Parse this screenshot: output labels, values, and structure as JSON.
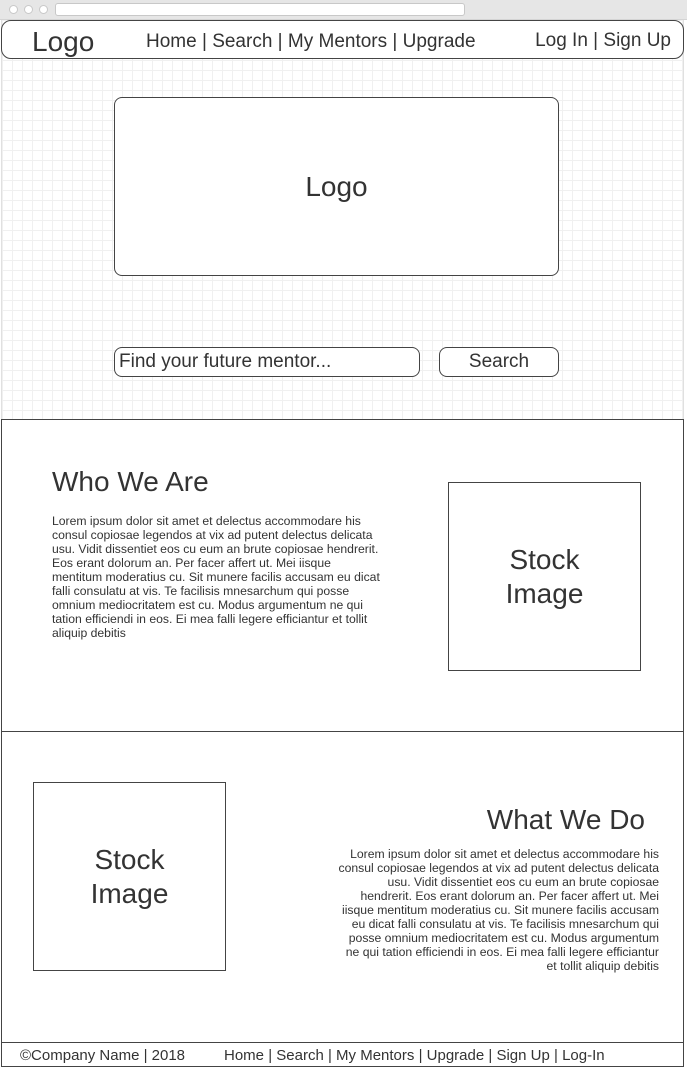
{
  "header": {
    "logo": "Logo",
    "nav": [
      "Home",
      "Search",
      "My Mentors",
      "Upgrade"
    ],
    "auth": [
      "Log In",
      "Sign Up"
    ],
    "separator": "|"
  },
  "hero": {
    "logo": "Logo",
    "search_placeholder": "Find your future mentor...",
    "search_button": "Search"
  },
  "who_we_are": {
    "title": "Who We Are",
    "body": "Lorem ipsum dolor sit amet et delectus accommodare his consul copiosae legendos at vix ad putent delectus delicata usu. Vidit dissentiet eos cu eum an brute copiosae hendrerit. Eos erant dolorum an. Per facer affert ut. Mei iisque mentitum moderatius cu. Sit munere facilis accusam eu dicat falli consulatu at vis. Te facilisis mnesarchum qui posse omnium mediocritatem est cu. Modus argumentum ne qui tation efficiendi in eos. Ei mea falli legere efficiantur et tollit aliquip debitis",
    "image": "Stock\nImage"
  },
  "what_we_do": {
    "title": "What We Do",
    "body": "Lorem ipsum dolor sit amet et delectus accommodare his consul copiosae legendos at vix ad putent delectus delicata usu. Vidit dissentiet eos cu eum an brute copiosae hendrerit. Eos erant dolorum an. Per facer affert ut. Mei iisque mentitum moderatius cu. Sit munere facilis accusam eu dicat falli consulatu at vis. Te facilisis mnesarchum qui posse omnium mediocritatem est cu. Modus argumentum ne qui tation efficiendi in eos. Ei mea falli legere efficiantur et tollit aliquip debitis",
    "image": "Stock\nImage"
  },
  "footer": {
    "copyright": "©Company Name | 2018",
    "nav": [
      "Home",
      "Search",
      "My Mentors",
      "Upgrade",
      "Sign Up",
      "Log-In"
    ]
  }
}
